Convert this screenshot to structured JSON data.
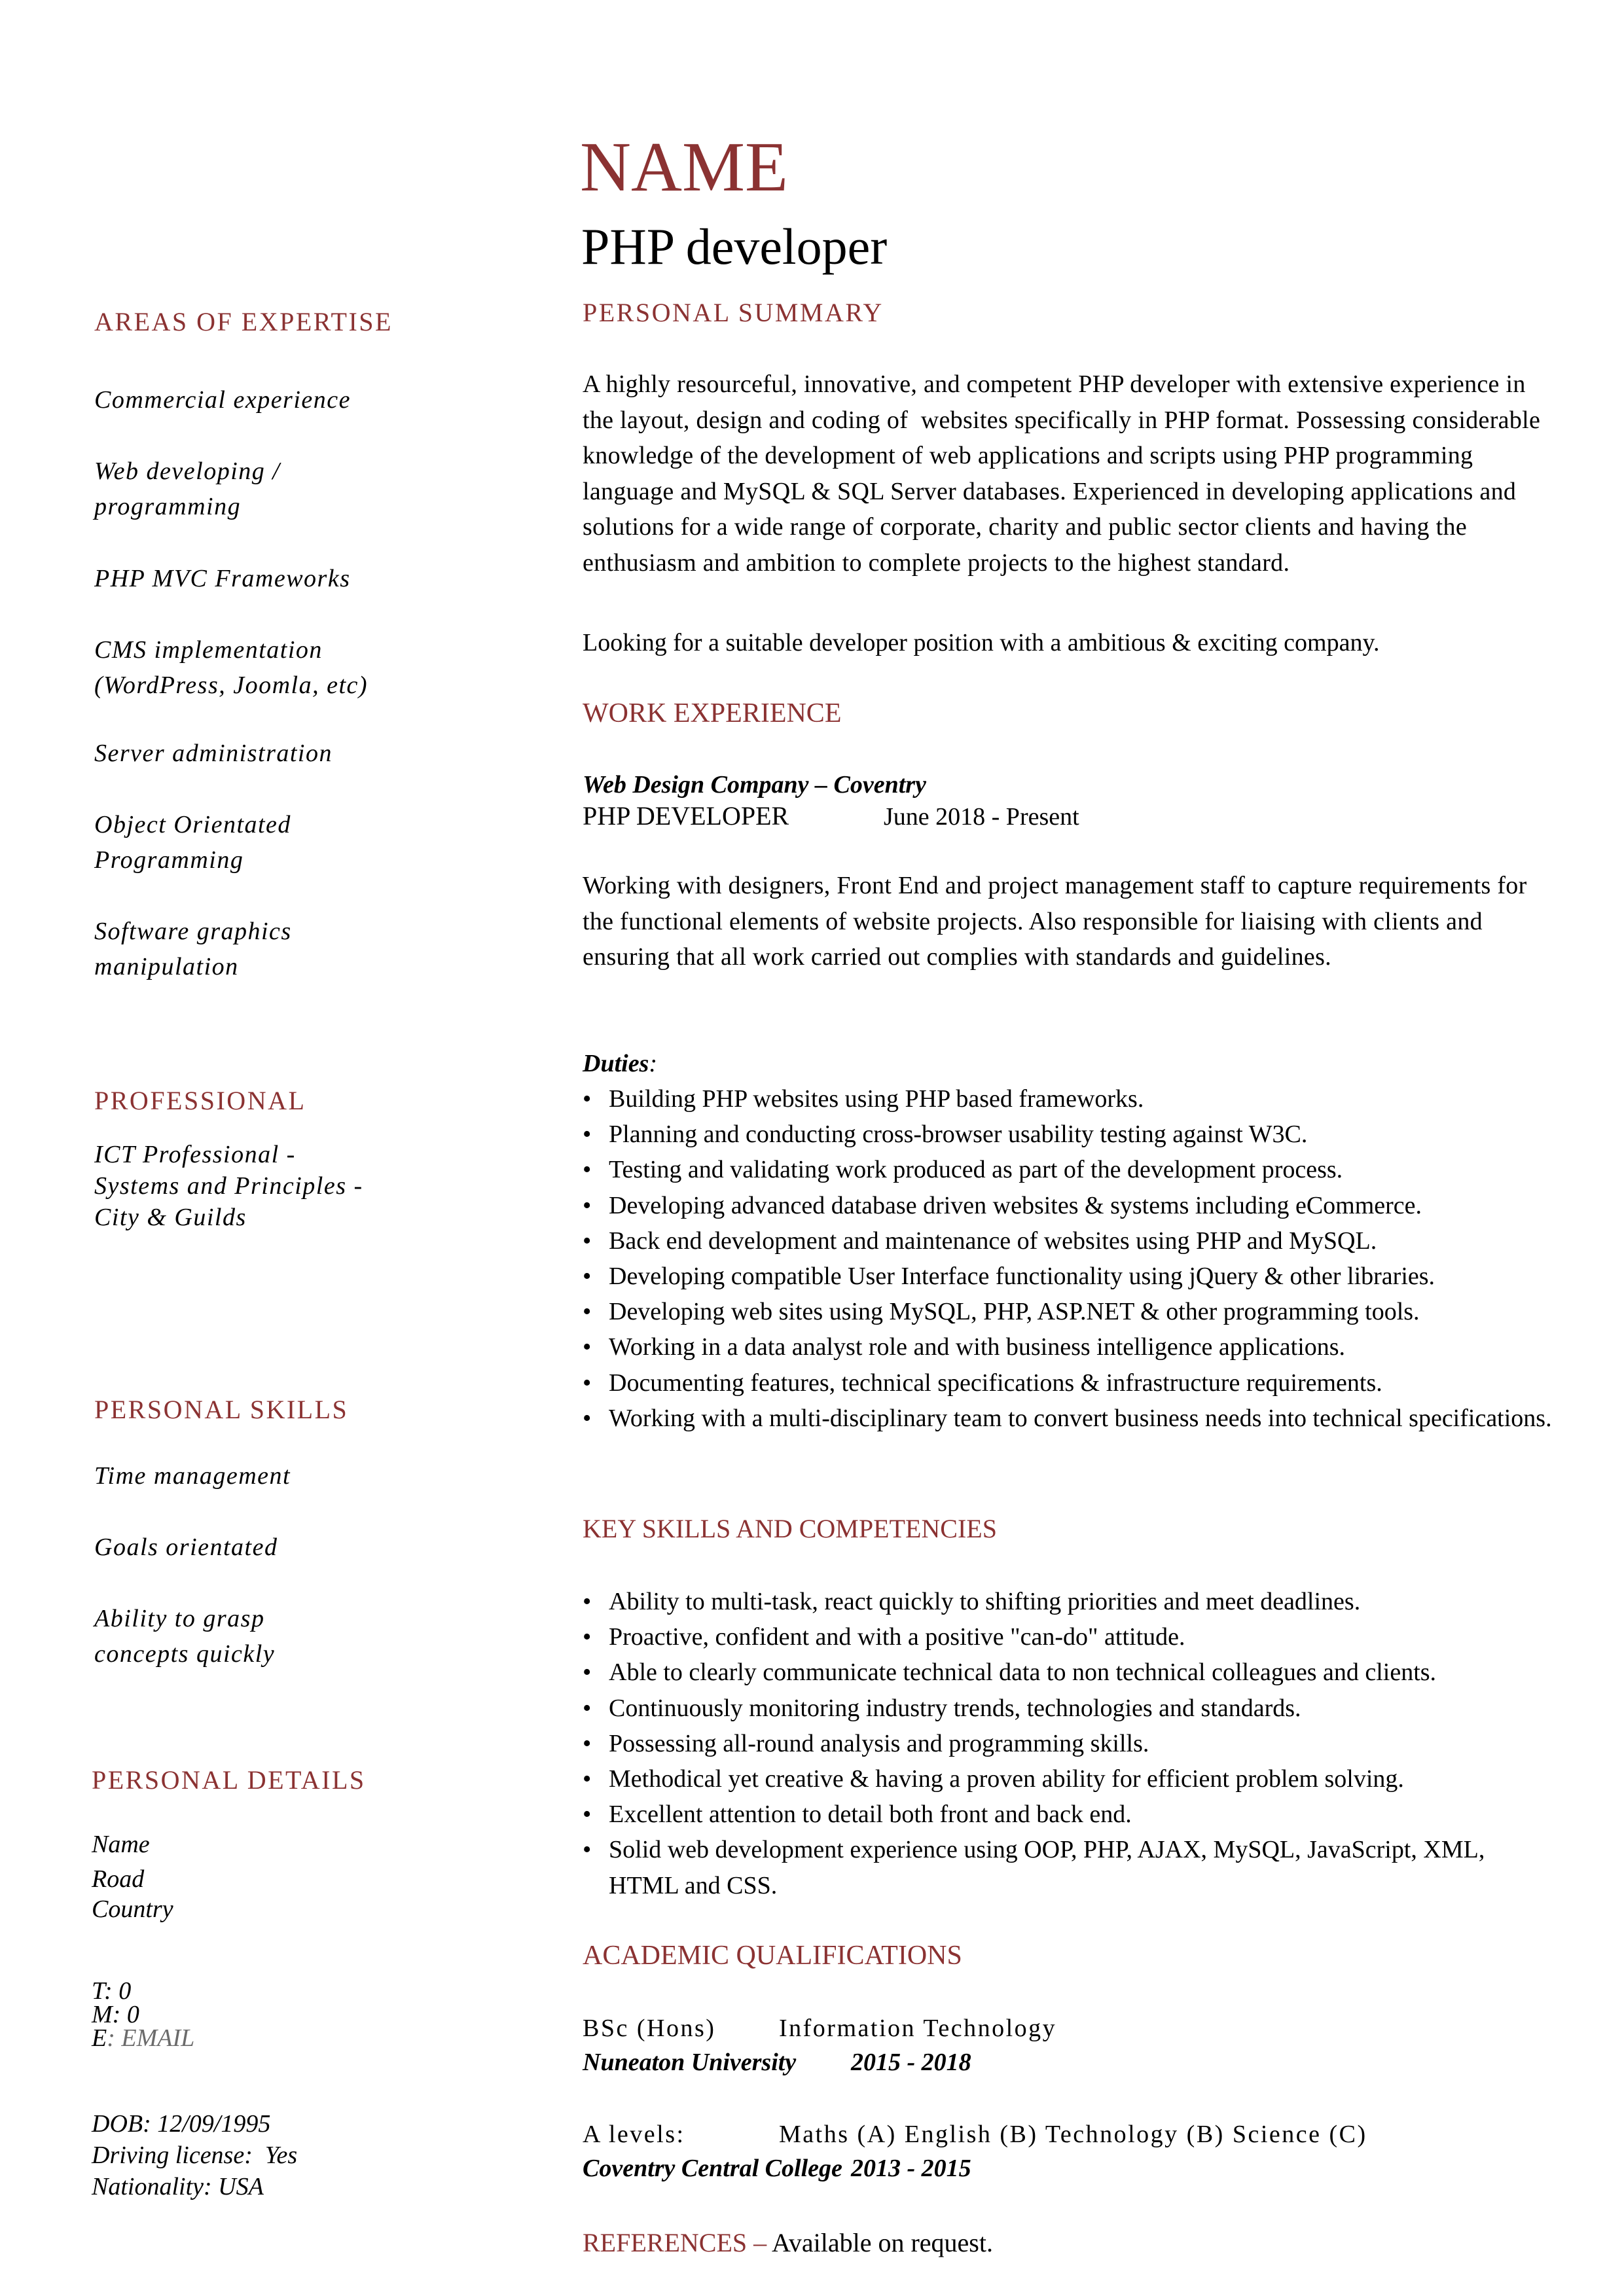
{
  "header": {
    "name": "NAME",
    "job_title": "PHP developer"
  },
  "colors": {
    "accent": "#8b3232",
    "text": "#000000",
    "email_placeholder": "#6b6b6b"
  },
  "sidebar": {
    "areas_of_expertise": {
      "heading": "AREAS OF EXPERTISE",
      "items": [
        "Commercial experience",
        "Web developing / programming",
        "PHP MVC Frameworks",
        "CMS implementation (WordPress, Joomla, etc)",
        "Server administration",
        "Object Orientated Programming",
        "Software graphics manipulation"
      ]
    },
    "professional": {
      "heading": "PROFESSIONAL",
      "text": "ICT Professional - Systems and Principles - City & Guilds"
    },
    "personal_skills": {
      "heading": "PERSONAL SKILLS",
      "items": [
        "Time management",
        "Goals orientated",
        "Ability to grasp concepts quickly"
      ]
    },
    "personal_details": {
      "heading": "PERSONAL DETAILS",
      "address": [
        "Name",
        "Road",
        "Country"
      ],
      "phone_label": "T: ",
      "phone": "0",
      "mobile_label": "M: ",
      "mobile": "0",
      "email_label": "E",
      "email_sep": ": ",
      "email": "EMAIL",
      "dob": "DOB: 12/09/1995",
      "driving_license": "Driving license:  Yes",
      "nationality": "Nationality: USA"
    }
  },
  "main": {
    "personal_summary": {
      "heading": "PERSONAL SUMMARY",
      "paragraphs": [
        "A highly resourceful, innovative, and competent PHP developer with extensive experience in the layout, design and coding of  websites specifically in PHP format. Possessing considerable knowledge of the development of web applications and scripts using PHP programming language and MySQL & SQL Server databases. Experienced in developing applications and solutions for a wide range of corporate, charity and public sector clients and having the enthusiasm and ambition to complete projects to the highest standard.",
        "Looking for a suitable developer position with a ambitious & exciting company."
      ]
    },
    "work_experience": {
      "heading": "WORK EXPERIENCE",
      "jobs": [
        {
          "company": "Web Design Company – Coventry",
          "role": "PHP DEVELOPER",
          "dates": "June 2018 - Present",
          "description": "Working with designers, Front End and project management staff to capture requirements for the functional elements of website projects. Also responsible for liaising with clients and ensuring that all work carried out complies with standards and guidelines.",
          "duties_label": "Duties",
          "duties_colon": ":",
          "duties": [
            "Building PHP websites using PHP based frameworks.",
            "Planning and conducting cross-browser usability testing against W3C.",
            "Testing and validating work produced as part of the development process.",
            "Developing advanced database driven websites & systems including eCommerce.",
            "Back end development and maintenance of websites using PHP and MySQL.",
            "Developing compatible User Interface functionality using jQuery & other libraries.",
            "Developing web sites using MySQL, PHP, ASP.NET & other programming tools.",
            "Working in a data analyst role and with business intelligence applications.",
            "Documenting features, technical specifications & infrastructure requirements.",
            "Working with a multi-disciplinary team to convert business needs into technical specifications."
          ]
        }
      ]
    },
    "key_skills": {
      "heading": "KEY SKILLS AND COMPETENCIES",
      "items": [
        "Ability to multi-task, react quickly to shifting priorities and meet deadlines.",
        "Proactive, confident and with a positive \"can-do\" attitude.",
        "Able to clearly communicate technical data to non technical colleagues and clients.",
        "Continuously monitoring industry trends, technologies and standards.",
        "Possessing all-round analysis and programming skills.",
        "Methodical yet creative & having a proven ability for efficient problem solving.",
        "Excellent attention to detail both front and back end.",
        "Solid web development experience using OOP, PHP, AJAX, MySQL, JavaScript, XML, HTML and CSS."
      ]
    },
    "academic": {
      "heading": "ACADEMIC QUALIFICATIONS",
      "entries": [
        {
          "qualification": "BSc (Hons)",
          "subject": "Information Technology",
          "institution": "Nuneaton University",
          "years": "2015 - 2018"
        },
        {
          "qualification": "A levels:",
          "subject": "Maths (A) English (B) Technology (B) Science (C)",
          "institution": "Coventry Central College",
          "years": "2013 - 2015"
        }
      ]
    },
    "references": {
      "heading": "REFERENCES",
      "separator": " – ",
      "text": "Available on request."
    }
  },
  "bullet_glyph": "•"
}
